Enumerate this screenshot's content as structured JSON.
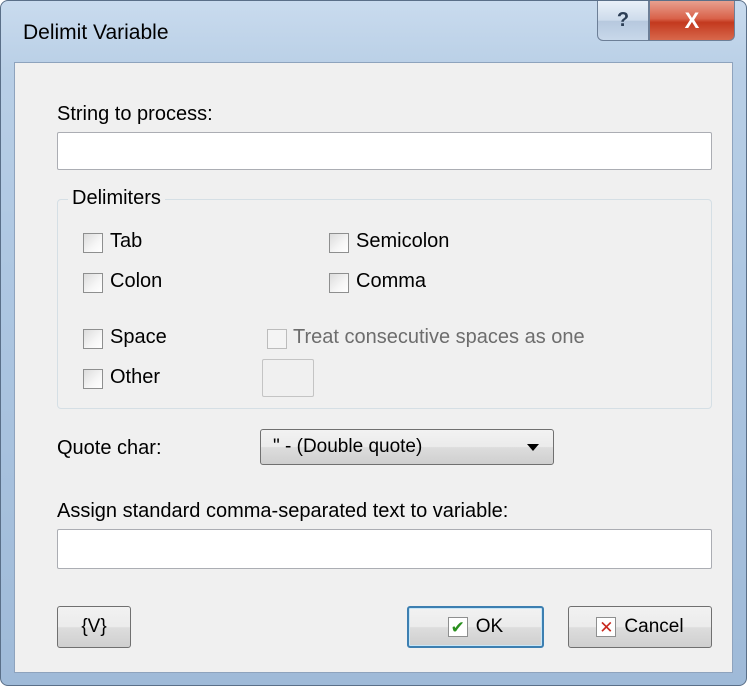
{
  "window": {
    "title": "Delimit Variable",
    "help_glyph": "?",
    "close_glyph": "X"
  },
  "string_to_process": {
    "label": "String to process:",
    "value": ""
  },
  "delimiters": {
    "group_label": "Delimiters",
    "tab": {
      "label": "Tab",
      "checked": false
    },
    "semicolon": {
      "label": "Semicolon",
      "checked": false
    },
    "colon": {
      "label": "Colon",
      "checked": false
    },
    "comma": {
      "label": "Comma",
      "checked": false
    },
    "space": {
      "label": "Space",
      "checked": false
    },
    "consecutive": {
      "label": "Treat consecutive spaces as one",
      "checked": false,
      "enabled": false
    },
    "other": {
      "label": "Other",
      "checked": false,
      "value": ""
    }
  },
  "quote_char": {
    "label": "Quote char:",
    "selected": "\" - (Double quote)"
  },
  "assign": {
    "label": "Assign standard comma-separated text to variable:",
    "value": ""
  },
  "buttons": {
    "variables": "{V}",
    "ok": "OK",
    "ok_icon": "✔",
    "cancel": "Cancel",
    "cancel_icon": "✕"
  },
  "colors": {
    "ok_check": "#2a8f1e",
    "cancel_x": "#c8281e"
  }
}
